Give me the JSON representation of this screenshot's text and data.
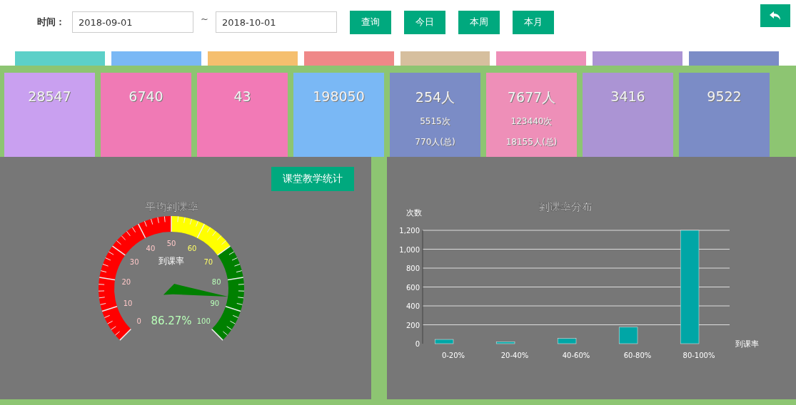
{
  "filter": {
    "label": "时间：",
    "from": "2018-09-01",
    "separator": "~",
    "to": "2018-10-01",
    "buttons": [
      "查询",
      "今日",
      "本周",
      "本月"
    ]
  },
  "tabs": [
    {
      "color": "#5cd0c8"
    },
    {
      "color": "#7ab8f5"
    },
    {
      "color": "#f5bf6e"
    },
    {
      "color": "#ef8888"
    },
    {
      "color": "#d6bf9e"
    },
    {
      "color": "#ee8fb8"
    },
    {
      "color": "#ab94d4"
    },
    {
      "color": "#7b8cc6"
    }
  ],
  "cards": [
    {
      "value": "28547",
      "color": "#c9a0f0"
    },
    {
      "value": "6740",
      "color": "#f07ab5"
    },
    {
      "value": "43",
      "color": "#f27ab6"
    },
    {
      "value": "198050",
      "color": "#7ab8f5"
    },
    {
      "value": "254人",
      "lines": [
        "5515次",
        "770人(总)"
      ],
      "color": "#7b8cc6"
    },
    {
      "value": "7677人",
      "lines": [
        "123440次",
        "18155人(总)"
      ],
      "color": "#ee8fb8"
    },
    {
      "value": "3416",
      "color": "#ab94d4"
    },
    {
      "value": "9522",
      "color": "#7b8cc6"
    }
  ],
  "gauge": {
    "button": "课堂教学统计",
    "title": "平均到课率",
    "name": "到课率",
    "value": "86.27%",
    "ticks": [
      "0",
      "10",
      "20",
      "30",
      "40",
      "50",
      "60",
      "70",
      "80",
      "90",
      "100"
    ],
    "bands": [
      {
        "color": "#ff0000"
      },
      {
        "color": "#ffff00"
      },
      {
        "color": "#008000"
      }
    ]
  },
  "bar_chart": {
    "chart_data": {
      "type": "bar",
      "grid": true,
      "title": "到课率分布",
      "ylabel": "次数",
      "xlabel": "到课率",
      "categories": [
        "0-20%",
        "20-40%",
        "40-60%",
        "60-80%",
        "80-100%"
      ],
      "series": [
        {
          "color": "#00a6a6",
          "values": [
            45,
            20,
            55,
            175,
            1200
          ]
        }
      ],
      "ylim": [
        0,
        1200
      ],
      "yticks": [
        {
          "value": 0,
          "label": "0"
        },
        {
          "value": 200,
          "label": "200"
        },
        {
          "value": 400,
          "label": "400"
        },
        {
          "value": 600,
          "label": "600"
        },
        {
          "value": 800,
          "label": "800"
        },
        {
          "value": 1000,
          "label": "1,000"
        },
        {
          "value": 1200,
          "label": "1,200"
        }
      ]
    }
  }
}
